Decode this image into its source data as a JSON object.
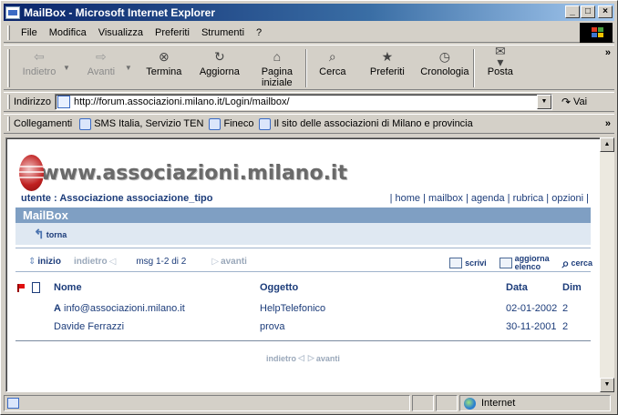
{
  "window": {
    "title": "MailBox - Microsoft Internet Explorer"
  },
  "menu": [
    "File",
    "Modifica",
    "Visualizza",
    "Preferiti",
    "Strumenti",
    "?"
  ],
  "toolbar": {
    "back": "Indietro",
    "forward": "Avanti",
    "stop": "Termina",
    "refresh": "Aggiorna",
    "home_line1": "Pagina",
    "home_line2": "iniziale",
    "search": "Cerca",
    "favorites": "Preferiti",
    "history": "Cronologia",
    "mail": "Posta"
  },
  "address": {
    "label": "Indirizzo",
    "url": "http://forum.associazioni.milano.it/Login/mailbox/",
    "go": "Vai"
  },
  "links": {
    "label": "Collegamenti",
    "items": [
      "SMS Italia, Servizio TEN",
      "Fineco",
      "Il sito delle associazioni di Milano e provincia"
    ]
  },
  "status": {
    "zone": "Internet"
  },
  "page": {
    "logo_text": "www.associazioni.milano.it",
    "user_line": "utente : Associazione associazione_tipo",
    "nav": [
      "home",
      "mailbox",
      "agenda",
      "rubrica",
      "opzioni"
    ],
    "section_title": "MailBox",
    "back_label": "torna",
    "pager": {
      "first": "inizio",
      "prev": "indietro",
      "range": "msg 1-2 di 2",
      "next": "avanti"
    },
    "tools": {
      "write": "scrivi",
      "refresh_line1": "aggiorna",
      "refresh_line2": "elenco",
      "search": "cerca"
    },
    "table": {
      "headers": {
        "name": "Nome",
        "subject": "Oggetto",
        "date": "Data",
        "size": "Dim"
      },
      "rows": [
        {
          "prefix": "A",
          "name": "info@associazioni.milano.it",
          "subject": "HelpTelefonico",
          "date": "02-01-2002",
          "size": "2"
        },
        {
          "prefix": "",
          "name": "Davide Ferrazzi",
          "subject": "prova",
          "date": "30-11-2001",
          "size": "2"
        }
      ]
    },
    "bottom_pager": {
      "prev": "indietro",
      "next": "avanti"
    }
  }
}
